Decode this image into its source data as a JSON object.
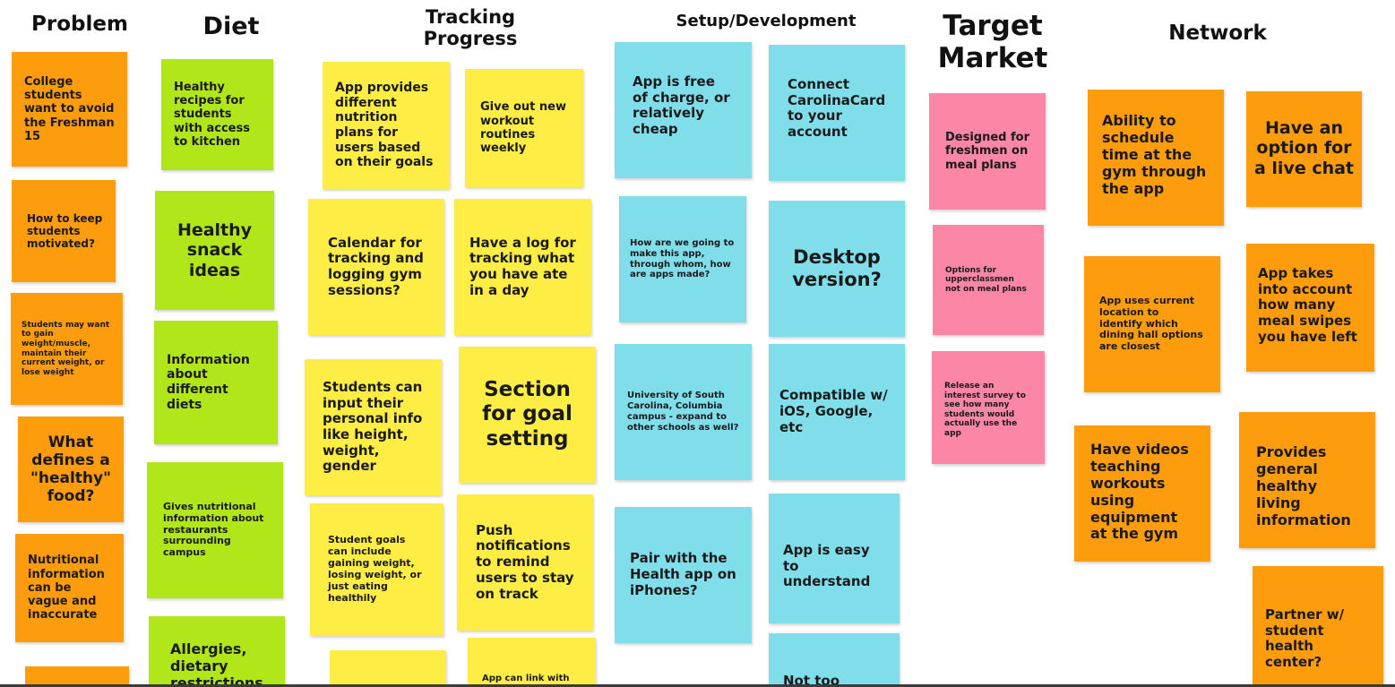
{
  "columns": {
    "problem": "Problem",
    "diet": "Diet",
    "tracking": "Tracking Progress",
    "setup": "Setup/Development",
    "target": "Target Market",
    "network": "Network"
  },
  "notes": {
    "p1": "College students want to avoid the Freshman 15",
    "p2": "How to keep students motivated?",
    "p3": "Students may want to gain weight/muscle, maintain their current weight, or lose weight",
    "p4": "What defines a \"healthy\" food?",
    "p5": "Nutritional information can be vague and inaccurate",
    "p6": "",
    "d1": "Healthy recipes for students with access to kitchen",
    "d2": "Healthy snack ideas",
    "d3": "Information about different diets",
    "d4": "Gives nutritional information about restaurants surrounding campus",
    "d5": "Allergies, dietary restrictions",
    "t1": "App provides different nutrition plans for users based on their goals",
    "t2": "Give out new workout routines weekly",
    "t3": "Calendar for tracking and logging gym sessions?",
    "t4": "Have a log for tracking what you have ate in a day",
    "t5": "Students can input their personal info like height, weight, gender",
    "t6": "Section for goal setting",
    "t7": "Student goals can include gaining weight, losing weight, or just eating healthily",
    "t8": "Push notifications to remind users to stay on track",
    "t9": "",
    "t10": "App can link with",
    "s1": "App is free of charge, or relatively cheap",
    "s2": "Connect CarolinaCard to your account",
    "s3": "How are we going to make this app, through whom, how are apps made?",
    "s4": "Desktop version?",
    "s5": "University of South Carolina, Columbia campus - expand to other schools as well?",
    "s6": "Compatible w/ iOS, Google, etc",
    "s7": "Pair with the Health app on iPhones?",
    "s8": "App is easy to understand",
    "s9": "Not too many",
    "m1": "Designed for freshmen on meal plans",
    "m2": "Options for upperclassmen not on meal plans",
    "m3": "Release an interest survey to see how many students would actually use the app",
    "n1": "Ability to schedule time at the gym through the app",
    "n2": "Have an option for a live chat",
    "n3": "App uses current location to identify which dining hall options are closest",
    "n4": "App takes into account how many meal swipes you have left",
    "n5": "Have videos teaching workouts using equipment at the gym",
    "n6": "Provides general healthy living information",
    "n7": "Partner w/ student health center?"
  },
  "colors": {
    "orange": "#fd9c0d",
    "green": "#b1e61a",
    "yellow": "#fded44",
    "blue": "#80deea",
    "pink": "#fb86a6"
  }
}
